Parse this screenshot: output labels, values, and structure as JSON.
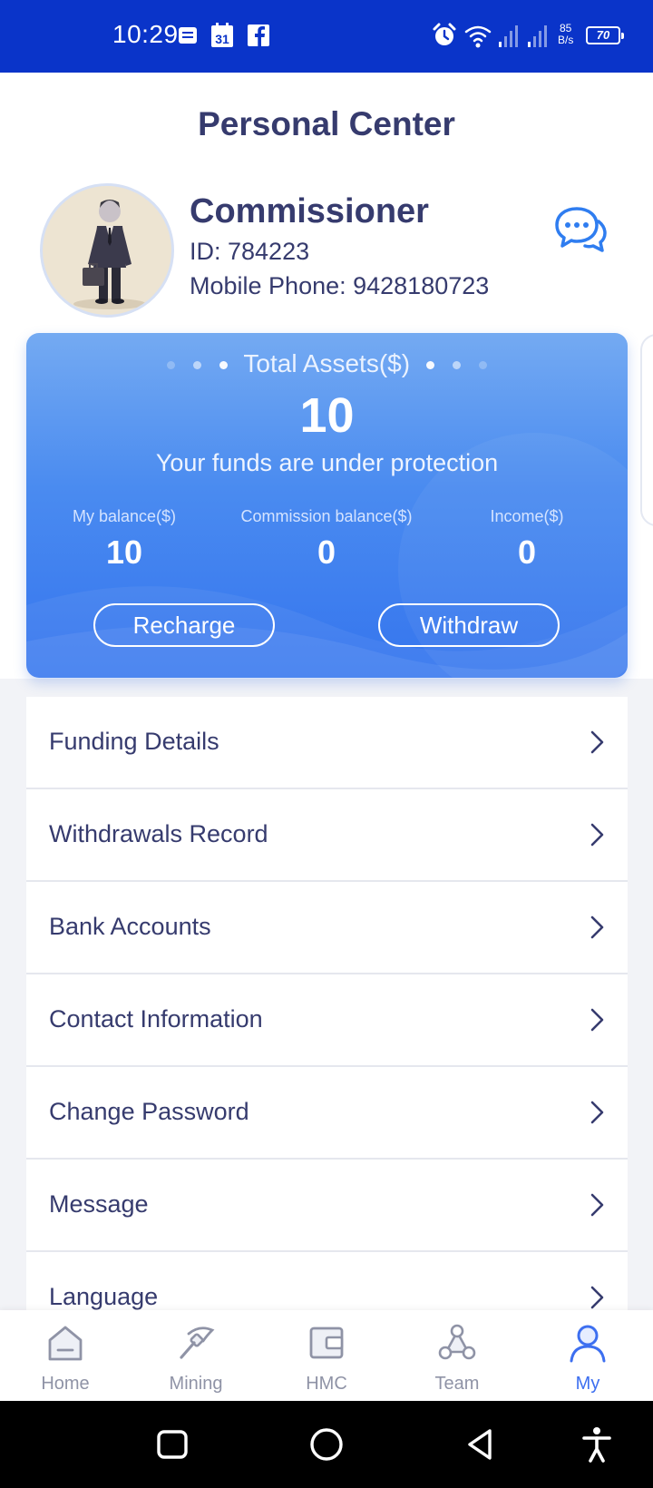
{
  "status_bar": {
    "time": "10:29",
    "notification_icons": [
      "message-icon",
      "calendar-icon",
      "facebook-icon"
    ],
    "calendar_day": "31",
    "net_speed_value": "85",
    "net_speed_unit": "B/s",
    "battery": "70"
  },
  "header": {
    "title": "Personal Center"
  },
  "profile": {
    "name": "Commissioner",
    "id_text": "ID: 784223",
    "phone_text": "Mobile Phone: 9428180723"
  },
  "assets": {
    "title": "Total Assets($)",
    "total": "10",
    "protection_text": "Your funds are under protection",
    "balances": [
      {
        "label": "My balance($)",
        "value": "10"
      },
      {
        "label": "Commission balance($)",
        "value": "0"
      },
      {
        "label": "Income($)",
        "value": "0"
      }
    ],
    "recharge_label": "Recharge",
    "withdraw_label": "Withdraw"
  },
  "menu": [
    {
      "label": "Funding Details"
    },
    {
      "label": "Withdrawals Record"
    },
    {
      "label": "Bank Accounts"
    },
    {
      "label": "Contact Information"
    },
    {
      "label": "Change Password"
    },
    {
      "label": "Message"
    },
    {
      "label": "Language"
    }
  ],
  "bottom_nav": [
    {
      "label": "Home",
      "icon": "home-icon"
    },
    {
      "label": "Mining",
      "icon": "pickaxe-icon"
    },
    {
      "label": "HMC",
      "icon": "wallet-icon"
    },
    {
      "label": "Team",
      "icon": "team-icon"
    },
    {
      "label": "My",
      "icon": "user-icon",
      "active": true
    }
  ],
  "colors": {
    "status_bar": "#0a34c9",
    "text_primary": "#363b6e",
    "card_blue": "#4a8bf0",
    "active_nav": "#3d6ff0",
    "inactive_nav": "#8f93a6"
  }
}
